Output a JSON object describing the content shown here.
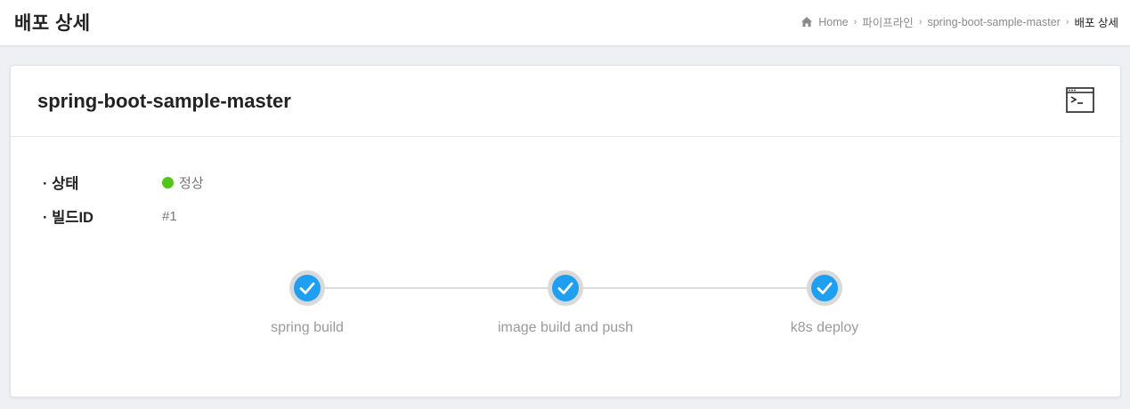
{
  "header": {
    "title": "배포 상세",
    "breadcrumb": {
      "home": "Home",
      "items": [
        "파이프라인",
        "spring-boot-sample-master"
      ],
      "current": "배포 상세"
    }
  },
  "card": {
    "title": "spring-boot-sample-master",
    "terminal_icon": "terminal-icon"
  },
  "info": {
    "status_label": "· 상태",
    "status_value": "정상",
    "build_label": "· 빌드ID",
    "build_value": "#1"
  },
  "pipeline": {
    "stages": [
      {
        "label": "spring build",
        "status": "success"
      },
      {
        "label": "image build and push",
        "status": "success"
      },
      {
        "label": "k8s deploy",
        "status": "success"
      }
    ]
  },
  "colors": {
    "success": "#52c41a",
    "stage_fill": "#1e9ff2",
    "stage_ring": "#d9d9d9"
  }
}
